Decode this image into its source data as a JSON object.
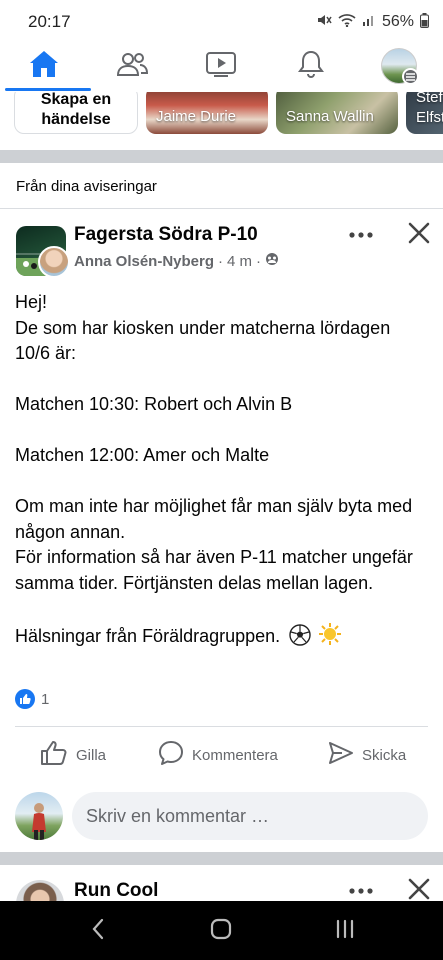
{
  "status_bar": {
    "time": "20:17",
    "battery": "56%"
  },
  "colors": {
    "accent": "#1877f2",
    "secondary_text": "#65676b",
    "divider": "#cdd0d4"
  },
  "nav": {
    "items": [
      {
        "name": "home-icon",
        "active": true
      },
      {
        "name": "friends-icon",
        "active": false
      },
      {
        "name": "watch-icon",
        "active": false
      },
      {
        "name": "notifications-bell-icon",
        "active": false
      },
      {
        "name": "profile-menu-avatar",
        "active": false
      }
    ]
  },
  "stories": {
    "create_label_line1": "Skapa en",
    "create_label_line2": "händelse",
    "items": [
      {
        "name": "Jaime Durie"
      },
      {
        "name": "Sanna Wallin"
      },
      {
        "name": "Stefan Elfstr"
      }
    ]
  },
  "section_label": "Från dina aviseringar",
  "post": {
    "group_name": "Fagersta Södra P-10",
    "author": "Anna Olsén-Nyberg",
    "time": "4 m",
    "body": {
      "greeting": "Hej!",
      "line2": "De som har kiosken under matcherna lördagen 10/6 är:",
      "match1": "Matchen 10:30: Robert och Alvin B",
      "match2": "Matchen 12:00: Amer och Malte",
      "line5": "Om man inte har möjlighet får man själv byta med någon annan.",
      "line6": "För information så har även P-11 matcher ungefär samma tider. Förtjänsten delas mellan lagen.",
      "closing": "Hälsningar från Föräldragruppen."
    },
    "reaction_count": "1",
    "actions": {
      "like": "Gilla",
      "comment": "Kommentera",
      "share": "Skicka"
    },
    "comment_placeholder": "Skriv en kommentar …"
  },
  "next_post": {
    "name": "Run Cool"
  }
}
